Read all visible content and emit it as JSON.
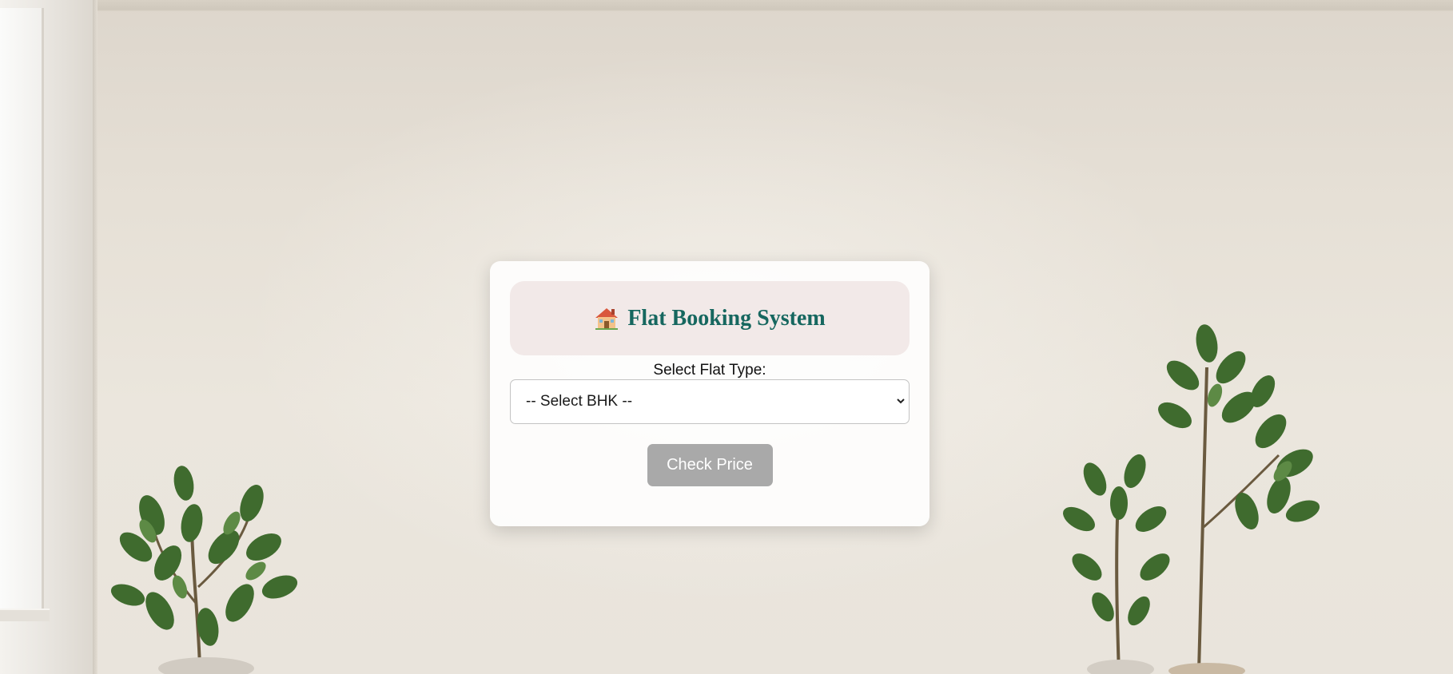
{
  "header": {
    "icon": "house-icon",
    "title": "Flat Booking System"
  },
  "form": {
    "flat_type_label": "Select Flat Type:",
    "bhk_select": {
      "selected": "-- Select BHK --",
      "icon": "chevron-down-icon"
    },
    "check_button_label": "Check Price"
  },
  "colors": {
    "title": "#16675f",
    "header_background": "#f2e9e8",
    "button_background": "#a9a9a9",
    "button_text": "#ffffff"
  }
}
